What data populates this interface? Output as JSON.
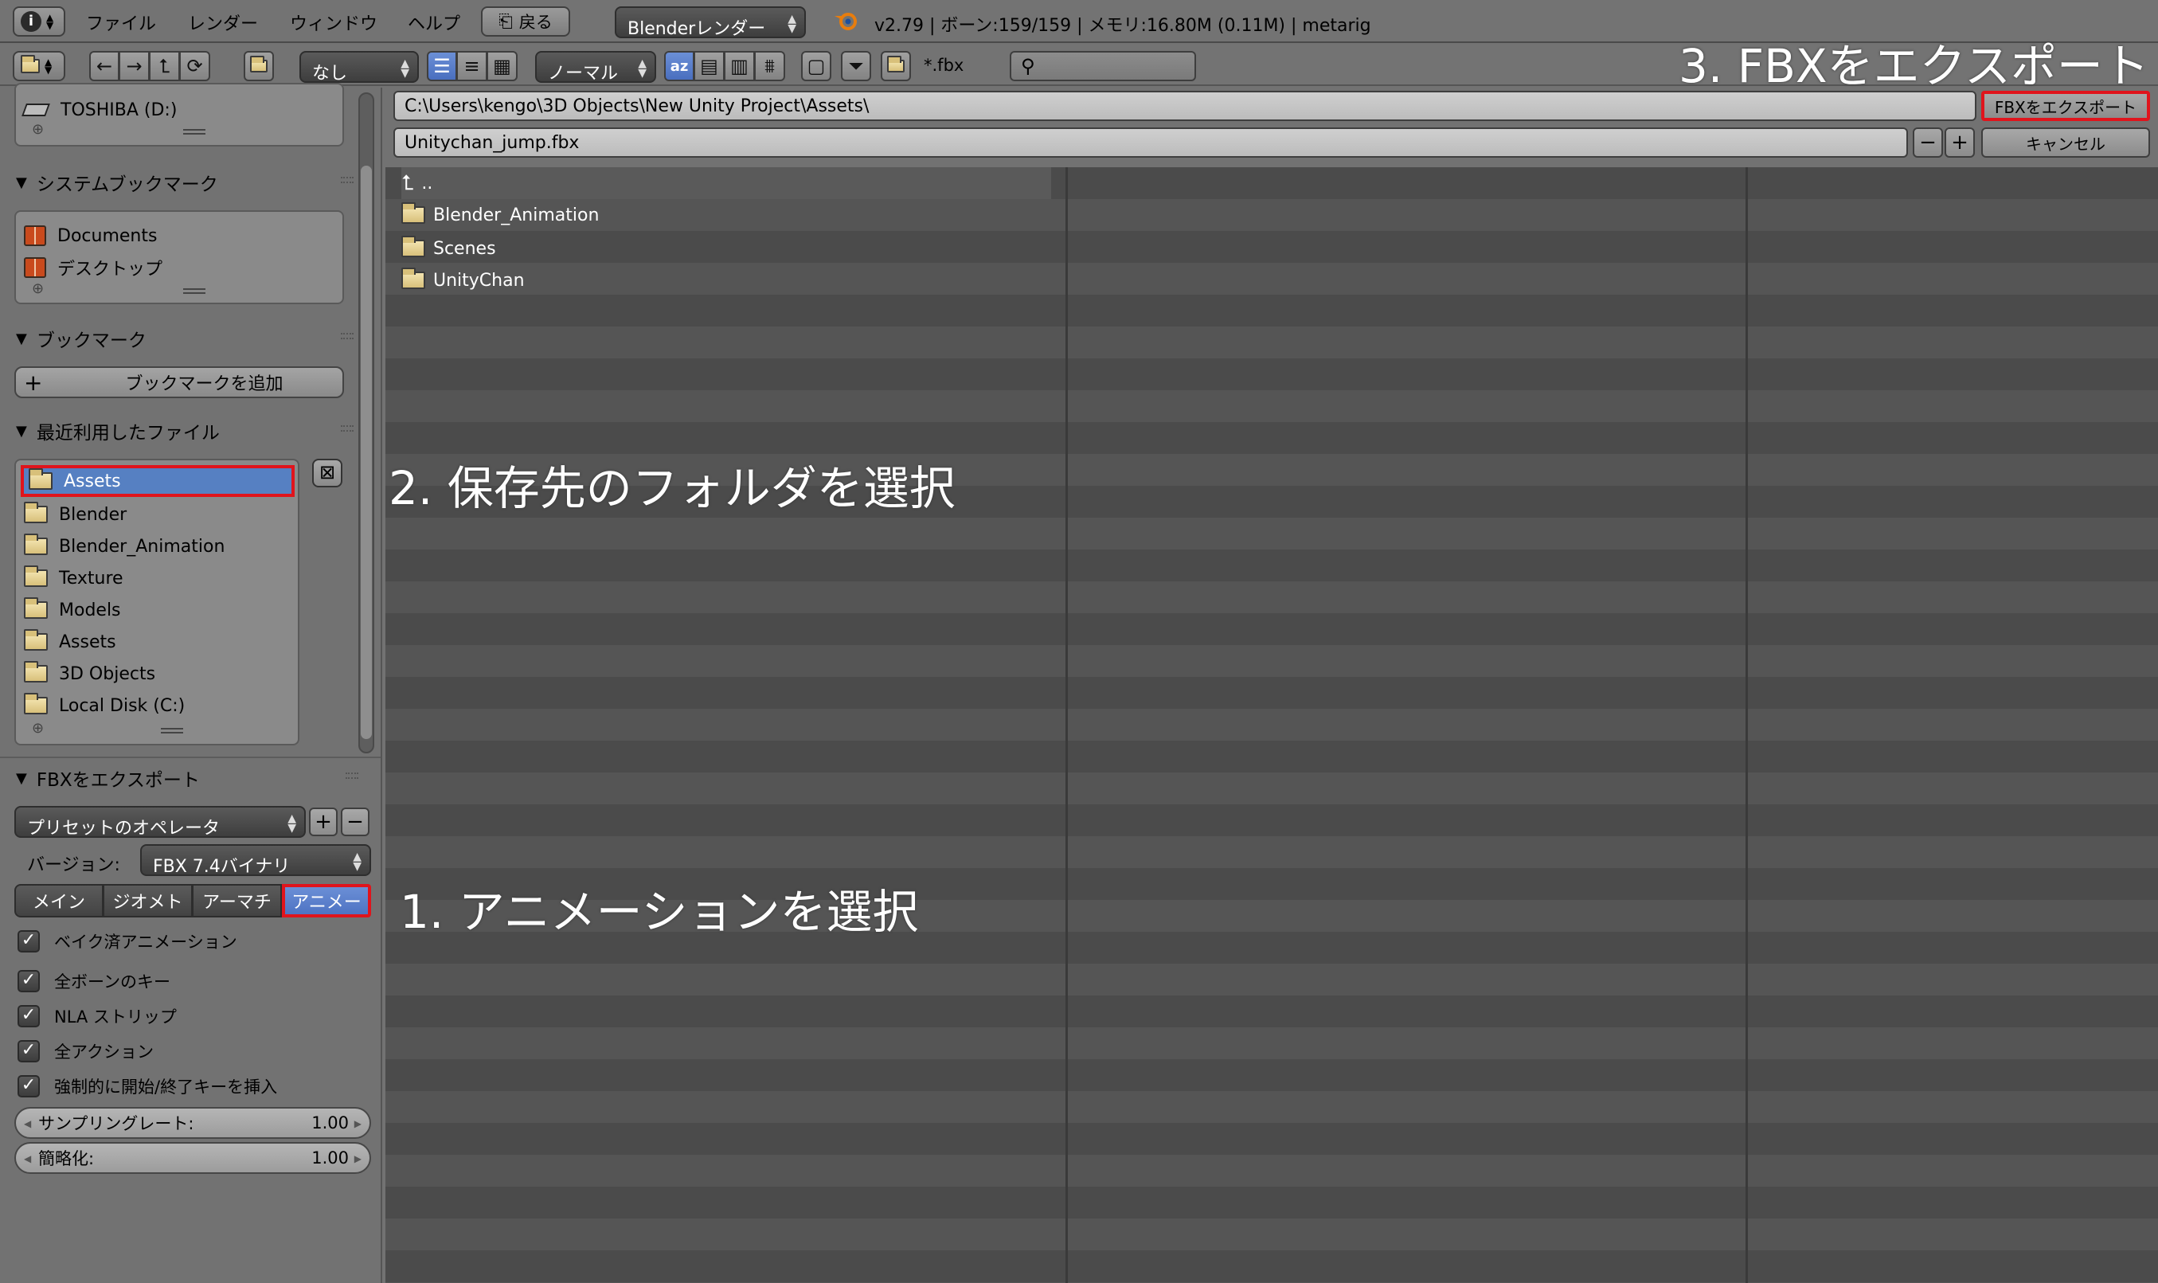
{
  "header": {
    "menus": [
      "ファイル",
      "レンダー",
      "ウィンドウ",
      "ヘルプ"
    ],
    "back_label": "戻る",
    "render_engine": "Blenderレンダー",
    "status": "v2.79 | ボーン:159/159  | メモリ:16.80M (0.11M) | metarig"
  },
  "toolbar": {
    "recursion": "なし",
    "display_size": "ノーマル",
    "filter_glob": "*.fbx",
    "search_value": ""
  },
  "sidebar": {
    "drive_item": "TOSHIBA (D:)",
    "system_bookmarks": {
      "title": "システムブックマーク",
      "items": [
        "Documents",
        "デスクトップ"
      ]
    },
    "bookmarks": {
      "title": "ブックマーク",
      "add_label": "ブックマークを追加"
    },
    "recent": {
      "title": "最近利用したファイル",
      "items": [
        "Assets",
        "Blender",
        "Blender_Animation",
        "Texture",
        "Models",
        "Assets",
        "3D Objects",
        "Local Disk (C:)"
      ]
    },
    "export": {
      "title": "FBXをエクスポート",
      "preset": "プリセットのオペレータ",
      "version_label": "バージョン:",
      "version_value": "FBX 7.4バイナリ",
      "tabs": [
        "メイン",
        "ジオメト",
        "アーマチ",
        "アニメー"
      ],
      "checks": [
        "ベイク済アニメーション",
        "全ボーンのキー",
        "NLA ストリップ",
        "全アクション",
        "強制的に開始/終了キーを挿入"
      ],
      "sampling_label": "サンプリングレート:",
      "sampling_value": "1.00",
      "simplify_label": "簡略化:",
      "simplify_value": "1.00"
    }
  },
  "main": {
    "path": "C:\\Users\\kengo\\3D Objects\\New Unity Project\\Assets\\",
    "filename": "Unitychan_jump.fbx",
    "export_button": "FBXをエクスポート",
    "cancel_button": "キャンセル",
    "parent_dir": "..",
    "files": [
      "Blender_Animation",
      "Scenes",
      "UnityChan"
    ]
  },
  "annotations": {
    "step1": "1. アニメーションを選択",
    "step2": "2. 保存先のフォルダを選択",
    "step3": "3. FBXをエクスポート"
  },
  "colors": {
    "highlight_red": "#e0141c",
    "selection_blue": "#5680c2"
  }
}
